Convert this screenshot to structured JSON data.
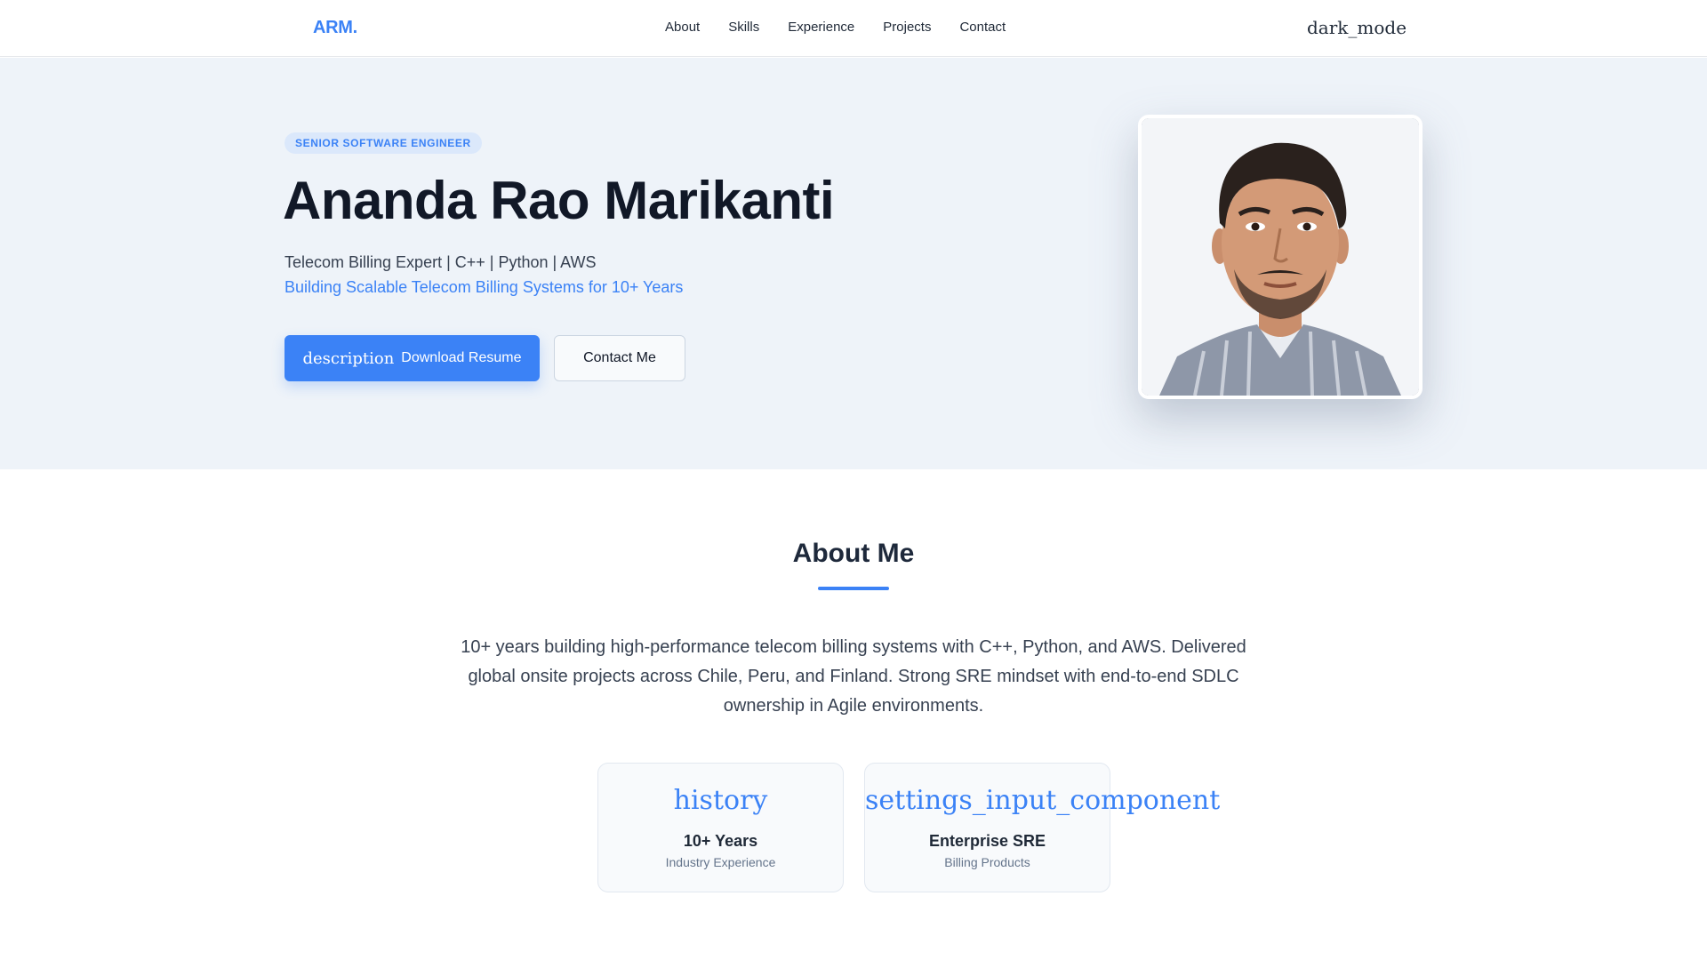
{
  "nav": {
    "logo": "ARM.",
    "links": [
      "About",
      "Skills",
      "Experience",
      "Projects",
      "Contact"
    ],
    "theme_toggle_icon": "dark_mode"
  },
  "hero": {
    "badge": "SENIOR SOFTWARE ENGINEER",
    "name": "Ananda Rao Marikanti",
    "tagline": "Telecom Billing Expert | C++ | Python | AWS",
    "subtagline": "Building Scalable Telecom Billing Systems for 10+ Years",
    "primary_button": {
      "icon": "description",
      "label": "Download Resume"
    },
    "secondary_button": {
      "label": "Contact Me"
    }
  },
  "about": {
    "title": "About Me",
    "text": "10+ years building high-performance telecom billing systems with C++, Python, and AWS. Delivered global onsite projects across Chile, Peru, and Finland. Strong SRE mindset with end-to-end SDLC ownership in Agile environments.",
    "stats": [
      {
        "icon": "history",
        "value": "10+ Years",
        "label": "Industry Experience"
      },
      {
        "icon": "settings_input_component",
        "value": "Enterprise SRE",
        "label": "Billing Products"
      }
    ]
  },
  "colors": {
    "accent": "#3b82f6",
    "hero_bg": "#eef3f9",
    "heading": "#111827"
  }
}
